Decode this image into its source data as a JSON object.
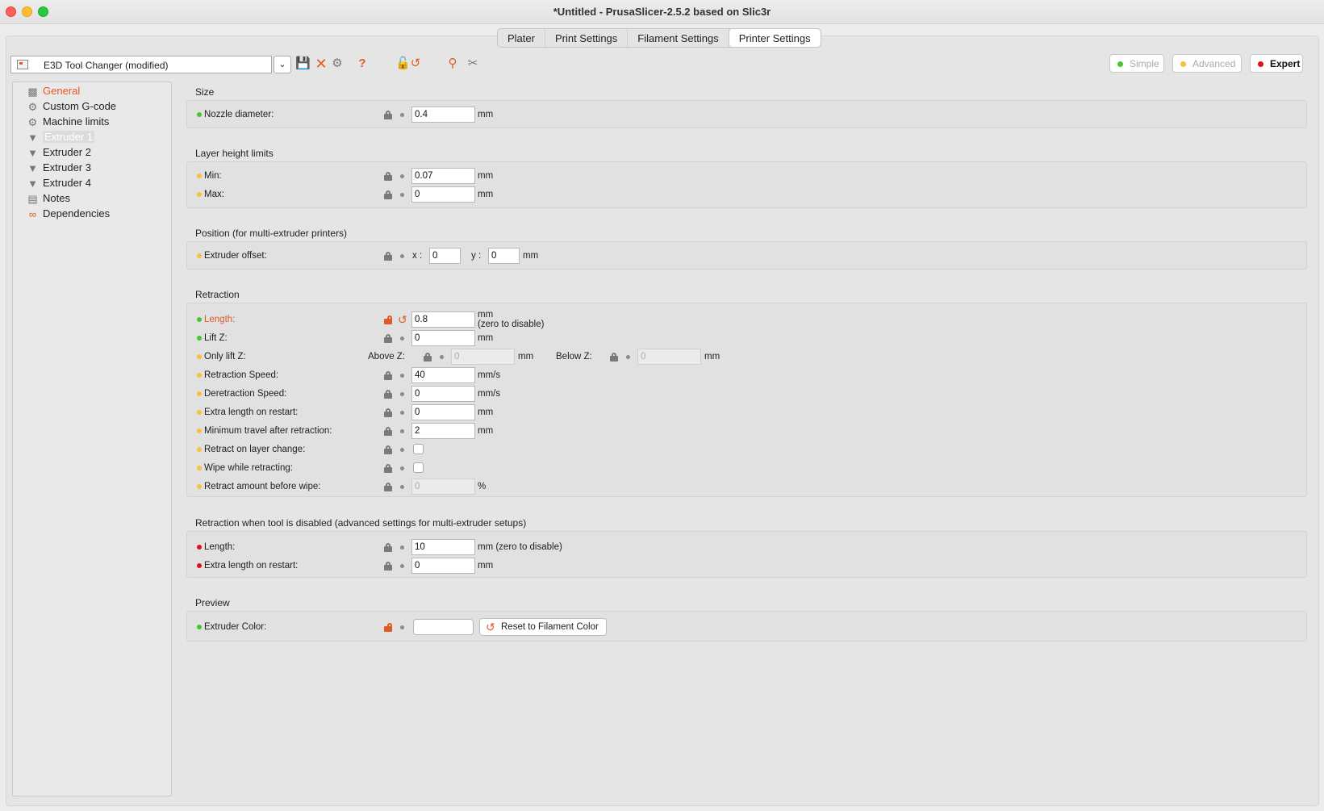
{
  "window": {
    "title": "*Untitled - PrusaSlicer-2.5.2 based on Slic3r"
  },
  "tabs": [
    {
      "label": "Plater"
    },
    {
      "label": "Print Settings"
    },
    {
      "label": "Filament Settings"
    },
    {
      "label": "Printer Settings",
      "active": true
    }
  ],
  "preset": {
    "value": "E3D Tool Changer (modified)"
  },
  "modes": {
    "simple": "Simple",
    "advanced": "Advanced",
    "expert": "Expert"
  },
  "tree": [
    {
      "label": "General",
      "icon": "printer-icon"
    },
    {
      "label": "Custom G-code",
      "icon": "gear-icon"
    },
    {
      "label": "Machine limits",
      "icon": "gear-icon"
    },
    {
      "label": "Extruder 1",
      "icon": "funnel-icon",
      "selected": true
    },
    {
      "label": "Extruder 2",
      "icon": "funnel-icon"
    },
    {
      "label": "Extruder 3",
      "icon": "funnel-icon"
    },
    {
      "label": "Extruder 4",
      "icon": "funnel-icon"
    },
    {
      "label": "Notes",
      "icon": "notes-icon"
    },
    {
      "label": "Dependencies",
      "icon": "dependencies-icon"
    }
  ],
  "sections": {
    "size": {
      "title": "Size",
      "nozzle_label": "Nozzle diameter:",
      "nozzle_value": "0.4",
      "nozzle_unit": "mm"
    },
    "layer": {
      "title": "Layer height limits",
      "min_label": "Min:",
      "min_value": "0.07",
      "min_unit": "mm",
      "max_label": "Max:",
      "max_value": "0",
      "max_unit": "mm"
    },
    "position": {
      "title": "Position (for multi-extruder printers)",
      "offset_label": "Extruder offset:",
      "x_label": "x :",
      "x_value": "0",
      "y_label": "y :",
      "y_value": "0",
      "unit": "mm"
    },
    "retraction": {
      "title": "Retraction",
      "length_label": "Length:",
      "length_value": "0.8",
      "length_unit": "mm",
      "length_sub": "(zero to disable)",
      "liftz_label": "Lift Z:",
      "liftz_value": "0",
      "liftz_unit": "mm",
      "onlylift_label": "Only lift Z:",
      "above_label": "Above Z:",
      "above_value": "0",
      "above_unit": "mm",
      "below_label": "Below Z:",
      "below_value": "0",
      "below_unit": "mm",
      "rspeed_label": "Retraction Speed:",
      "rspeed_value": "40",
      "rspeed_unit": "mm/s",
      "dspeed_label": "Deretraction Speed:",
      "dspeed_value": "0",
      "dspeed_unit": "mm/s",
      "extra_label": "Extra length on restart:",
      "extra_value": "0",
      "extra_unit": "mm",
      "mintravel_label": "Minimum travel after retraction:",
      "mintravel_value": "2",
      "mintravel_unit": "mm",
      "layerchange_label": "Retract on layer change:",
      "wipe_label": "Wipe while retracting:",
      "beforewipe_label": "Retract amount before wipe:",
      "beforewipe_value": "0",
      "beforewipe_unit": "%"
    },
    "toolretract": {
      "title": "Retraction when tool is disabled (advanced settings for multi-extruder setups)",
      "length_label": "Length:",
      "length_value": "10",
      "length_unit": "mm (zero to disable)",
      "extra_label": "Extra length on restart:",
      "extra_value": "0",
      "extra_unit": "mm"
    },
    "preview": {
      "title": "Preview",
      "color_label": "Extruder Color:",
      "color_value": "",
      "reset_label": "Reset to Filament Color"
    }
  },
  "colors": {
    "accent": "#e05a26",
    "simple": "#48c630",
    "advanced": "#f6c338",
    "expert": "#e0101a"
  }
}
